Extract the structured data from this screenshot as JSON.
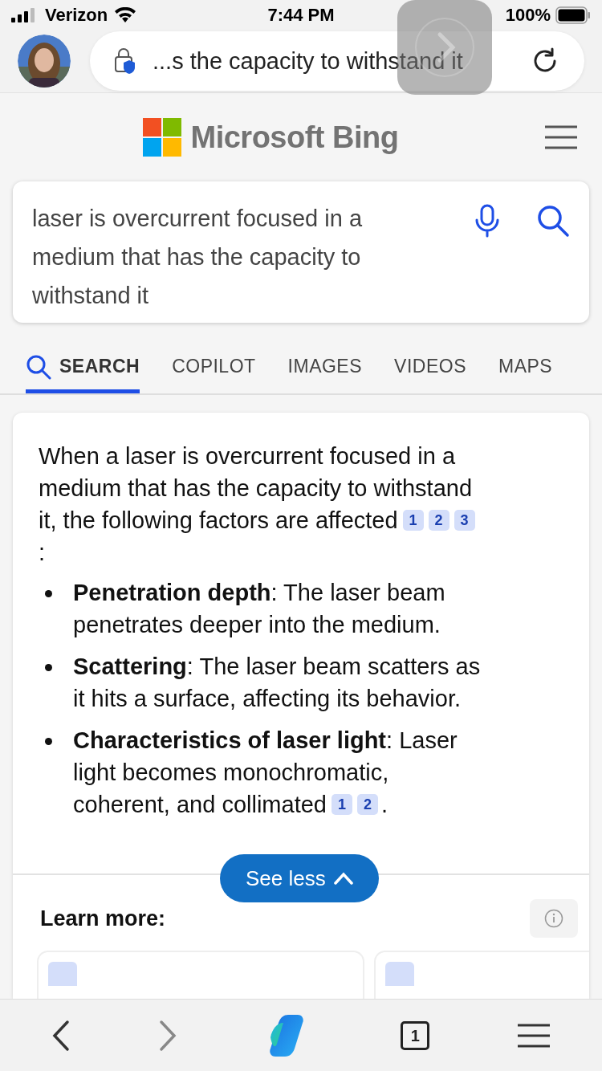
{
  "status_bar": {
    "carrier": "Verizon",
    "time": "7:44 PM",
    "battery": "100%"
  },
  "address_bar": {
    "url": "...s the capacity to withstand it"
  },
  "header": {
    "logo_text": "Microsoft Bing"
  },
  "search": {
    "query": "laser is overcurrent focused in a medium that has the capacity to withstand it"
  },
  "tabs": [
    {
      "label": "SEARCH",
      "selected": true
    },
    {
      "label": "COPILOT",
      "selected": false
    },
    {
      "label": "IMAGES",
      "selected": false
    },
    {
      "label": "VIDEOS",
      "selected": false
    },
    {
      "label": "MAPS",
      "selected": false
    }
  ],
  "answer": {
    "intro": {
      "lines": [
        "When a laser is overcurrent focused in a",
        "medium that has the capacity to withstand",
        "it, the following factors are affected"
      ],
      "citations": [
        "1",
        "2",
        "3"
      ],
      "trailing": ":"
    },
    "bullets": [
      {
        "lines": [
          "**Penetration depth**: The laser beam",
          "penetrates deeper into the medium."
        ]
      },
      {
        "lines": [
          "**Scattering**: The laser beam scatters as",
          "it hits a surface, affecting its behavior."
        ]
      },
      {
        "lines": [
          "**Characteristics of laser light**: Laser",
          "light becomes monochromatic,",
          "coherent, and collimated"
        ],
        "citations": [
          "1",
          "2"
        ],
        "trailing": "."
      }
    ],
    "toggle": "See less",
    "learn_more": "Learn more:"
  },
  "bottom_bar": {
    "tab_count": "1"
  }
}
